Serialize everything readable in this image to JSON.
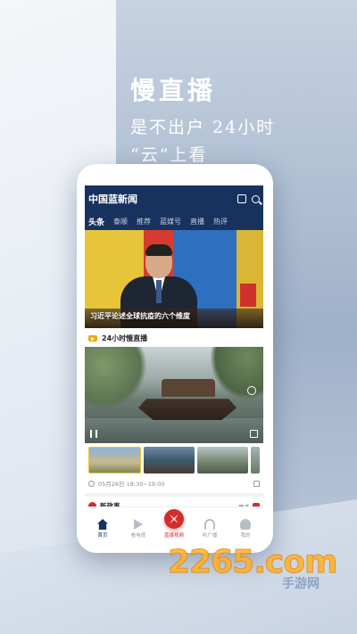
{
  "promo": {
    "headline": "慢直播",
    "line2": "是不出户 24小时",
    "line3": "“云”上看"
  },
  "app": {
    "title": "中国蓝新闻",
    "tabs": [
      {
        "label": "头条",
        "active": true
      },
      {
        "label": "泰顺"
      },
      {
        "label": "推荐"
      },
      {
        "label": "蓝媒号"
      },
      {
        "label": "直播"
      },
      {
        "label": "热评"
      }
    ],
    "hero_caption": "习近平论述全球抗疫的六个维度",
    "live_section_title": "24小时慢直播",
    "live_time": "05月26日 18:30~19:00",
    "news_section_label": "新政事",
    "more_label": "更多",
    "nav": [
      {
        "label": "首页",
        "icon": "home-icon"
      },
      {
        "label": "看电视",
        "icon": "tv-icon"
      },
      {
        "label": "蓝媒视频",
        "icon": "video-icon"
      },
      {
        "label": "听广播",
        "icon": "headphones-icon"
      },
      {
        "label": "我的",
        "icon": "user-icon"
      }
    ]
  },
  "watermark": {
    "main": "2265.com",
    "sub": "手游网"
  },
  "colors": {
    "brand_navy": "#17325f",
    "accent_red": "#d52b2b",
    "live_orange": "#f0a818"
  }
}
